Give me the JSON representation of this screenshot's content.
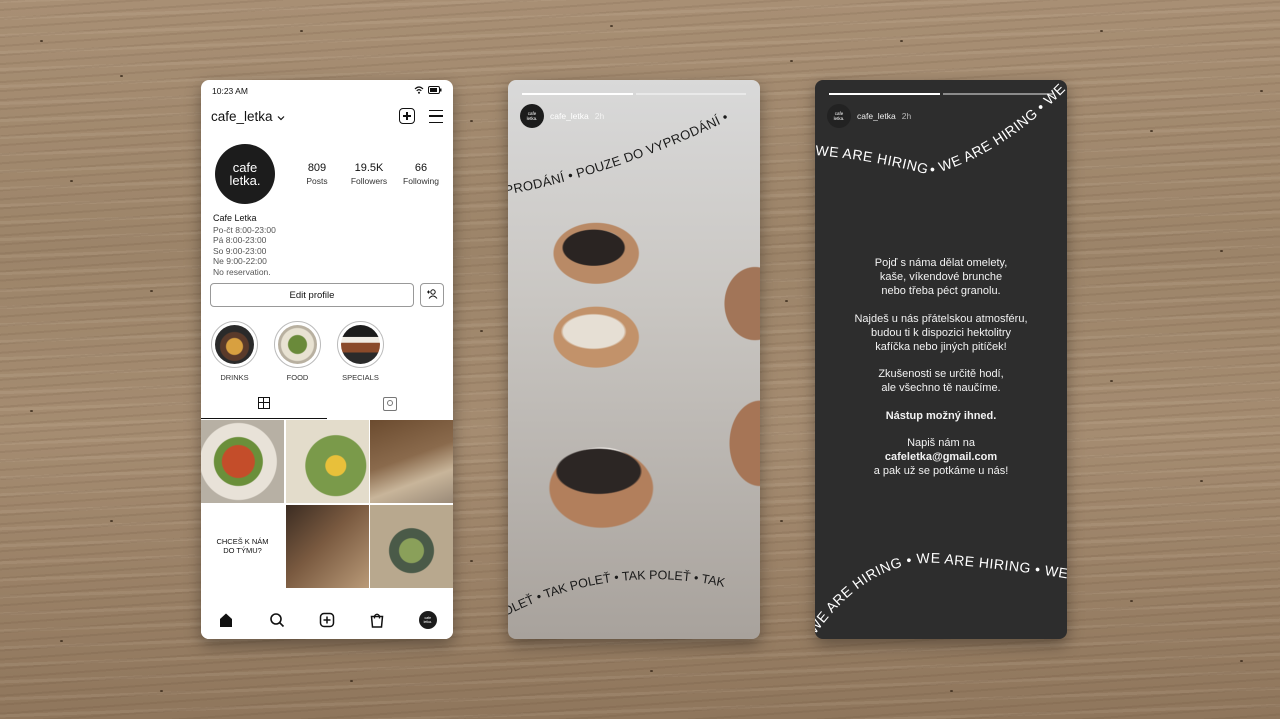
{
  "profile_phone": {
    "status_time": "10:23 AM",
    "username": "cafe_letka",
    "avatar_text": [
      "cafe",
      "letka."
    ],
    "stats": [
      {
        "value": "809",
        "label": "Posts"
      },
      {
        "value": "19.5K",
        "label": "Followers"
      },
      {
        "value": "66",
        "label": "Following"
      }
    ],
    "bio": {
      "name": "Cafe Letka",
      "lines": [
        "Po-čt 8:00-23:00",
        "Pá 8:00-23:00",
        "So 9:00-23:00",
        "Ne 9:00-22:00",
        "No reservation."
      ]
    },
    "edit_profile_label": "Edit profile",
    "highlights": [
      {
        "label": "DRINKS",
        "color": "#8a6a3a"
      },
      {
        "label": "FOOD",
        "color": "#7a9a4a"
      },
      {
        "label": "SPECIALS",
        "color": "#6a5040"
      }
    ],
    "grid_text_post": [
      "CHCEŠ K NÁM",
      "DO TÝMU?"
    ]
  },
  "story_bakery": {
    "username": "cafe_letka",
    "time": "2h",
    "top_arc_text": "VYPRODÁNÍ • POUZE DO VYPRODÁNÍ •",
    "bottom_arc_text_1": "POLEŤ • TAK POLEŤ • TAK POLEŤ • TAK",
    "bottom_arc_text_2": "POLEŤ • TAK POLEŤ"
  },
  "story_hiring": {
    "username": "cafe_letka",
    "time": "2h",
    "top_arc_text": "WE ARE HIRING • WE ARE HIRING • WE",
    "bottom_arc_text": "WE ARE HIRING • WE ARE HIRING • WE",
    "paragraphs": [
      [
        "Pojď s náma dělat omelety,",
        "kaše, víkendové brunche",
        "nebo třeba péct granolu."
      ],
      [
        "Najdeš u nás přátelskou atmosféru,",
        "budou ti k dispozici hektolitry",
        "kafíčka nebo jiných pitíček!"
      ],
      [
        "Zkušenosti se určitě hodí,",
        "ale všechno tě naučíme."
      ]
    ],
    "start_line": "Nástup možný ihned.",
    "contact_intro": "Napiš nám na",
    "email": "cafeletka@gmail.com",
    "closing": "a pak už se potkáme u nás!"
  }
}
